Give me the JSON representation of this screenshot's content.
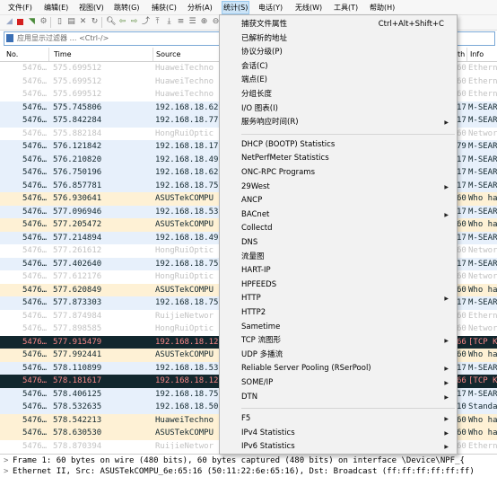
{
  "menubar": [
    "文件(F)",
    "编辑(E)",
    "视图(V)",
    "跳转(G)",
    "捕获(C)",
    "分析(A)",
    "统计(S)",
    "电话(Y)",
    "无线(W)",
    "工具(T)",
    "帮助(H)"
  ],
  "filter": {
    "placeholder": "应用显示过滤器 … <Ctrl-/>"
  },
  "columns": {
    "no": "No.",
    "time": "Time",
    "source": "Source",
    "length_fragment": "th",
    "info": "Info"
  },
  "packets": [
    {
      "no": "5476…",
      "time": "575.699512",
      "src": "HuaweiTechno",
      "len": "60",
      "info": "Ethern",
      "style": "gray"
    },
    {
      "no": "5476…",
      "time": "575.699512",
      "src": "HuaweiTechno",
      "len": "60",
      "info": "Ethern",
      "style": "gray"
    },
    {
      "no": "5476…",
      "time": "575.699512",
      "src": "HuaweiTechno",
      "len": "60",
      "info": "Ethern",
      "style": "gray"
    },
    {
      "no": "5476…",
      "time": "575.745806",
      "src": "192.168.18.62",
      "len": "17",
      "info": "M-SEAR",
      "style": "blue"
    },
    {
      "no": "5476…",
      "time": "575.842284",
      "src": "192.168.18.77",
      "len": "17",
      "info": "M-SEAR",
      "style": "blue"
    },
    {
      "no": "5476…",
      "time": "575.882184",
      "src": "HongRuiOptic",
      "len": "60",
      "info": "Networ",
      "style": "gray"
    },
    {
      "no": "5476…",
      "time": "576.121842",
      "src": "192.168.18.17",
      "len": "79",
      "info": "M-SEAR",
      "style": "blue"
    },
    {
      "no": "5476…",
      "time": "576.210820",
      "src": "192.168.18.49",
      "len": "17",
      "info": "M-SEAR",
      "style": "blue"
    },
    {
      "no": "5476…",
      "time": "576.750196",
      "src": "192.168.18.62",
      "len": "17",
      "info": "M-SEAR",
      "style": "blue"
    },
    {
      "no": "5476…",
      "time": "576.857781",
      "src": "192.168.18.75",
      "len": "17",
      "info": "M-SEAR",
      "style": "blue"
    },
    {
      "no": "5476…",
      "time": "576.930641",
      "src": "ASUSTekCOMPU",
      "len": "60",
      "info": "Who ha",
      "style": "tan"
    },
    {
      "no": "5476…",
      "time": "577.096946",
      "src": "192.168.18.53",
      "len": "17",
      "info": "M-SEAR",
      "style": "blue"
    },
    {
      "no": "5476…",
      "time": "577.205472",
      "src": "ASUSTekCOMPU",
      "len": "60",
      "info": "Who ha",
      "style": "tan"
    },
    {
      "no": "5476…",
      "time": "577.214894",
      "src": "192.168.18.49",
      "len": "17",
      "info": "M-SEAR",
      "style": "blue"
    },
    {
      "no": "5476…",
      "time": "577.261612",
      "src": "HongRuiOptic",
      "len": "60",
      "info": "Networ",
      "style": "gray"
    },
    {
      "no": "5476…",
      "time": "577.402640",
      "src": "192.168.18.75",
      "len": "17",
      "info": "M-SEAR",
      "style": "blue"
    },
    {
      "no": "5476…",
      "time": "577.612176",
      "src": "HongRuiOptic",
      "len": "60",
      "info": "Networ",
      "style": "gray"
    },
    {
      "no": "5476…",
      "time": "577.620849",
      "src": "ASUSTekCOMPU",
      "len": "60",
      "info": "Who ha",
      "style": "tan"
    },
    {
      "no": "5476…",
      "time": "577.873303",
      "src": "192.168.18.75",
      "len": "17",
      "info": "M-SEAR",
      "style": "blue"
    },
    {
      "no": "5476…",
      "time": "577.874984",
      "src": "RuijieNetwor",
      "len": "60",
      "info": "Ethern",
      "style": "gray"
    },
    {
      "no": "5476…",
      "time": "577.898585",
      "src": "HongRuiOptic",
      "len": "60",
      "info": "Networ",
      "style": "gray"
    },
    {
      "no": "5476…",
      "time": "577.915479",
      "src": "192.168.18.12",
      "len": "66",
      "info": "[TCP K",
      "style": "sel"
    },
    {
      "no": "5476…",
      "time": "577.992441",
      "src": "ASUSTekCOMPU",
      "len": "60",
      "info": "Who ha",
      "style": "tan"
    },
    {
      "no": "5476…",
      "time": "578.110899",
      "src": "192.168.18.53",
      "len": "17",
      "info": "M-SEAR",
      "style": "blue"
    },
    {
      "no": "5476…",
      "time": "578.181617",
      "src": "192.168.18.12",
      "len": "66",
      "info": "[TCP K",
      "style": "sel"
    },
    {
      "no": "5476…",
      "time": "578.406125",
      "src": "192.168.18.75",
      "len": "17",
      "info": "M-SEAR",
      "style": "blue"
    },
    {
      "no": "5476…",
      "time": "578.532635",
      "src": "192.168.18.50",
      "len": "10",
      "info": "Standa",
      "style": "blue"
    },
    {
      "no": "5476…",
      "time": "578.542213",
      "src": "HuaweiTechno",
      "len": "60",
      "info": "Who ha",
      "style": "tan"
    },
    {
      "no": "5476…",
      "time": "578.630530",
      "src": "ASUSTekCOMPU",
      "len": "60",
      "info": "Who ha",
      "style": "tan"
    },
    {
      "no": "5476…",
      "time": "578.870394",
      "src": "RuijieNetwor",
      "len": "60",
      "info": "Ethern",
      "style": "gray"
    }
  ],
  "statistics_menu": {
    "items": [
      {
        "label": "捕获文件属性",
        "shortcut": "Ctrl+Alt+Shift+C",
        "submenu": false
      },
      {
        "label": "已解析的地址",
        "shortcut": "",
        "submenu": false
      },
      {
        "label": "协议分级(P)",
        "shortcut": "",
        "submenu": false
      },
      {
        "label": "会话(C)",
        "shortcut": "",
        "submenu": false
      },
      {
        "label": "端点(E)",
        "shortcut": "",
        "submenu": false
      },
      {
        "label": "分组长度",
        "shortcut": "",
        "submenu": false
      },
      {
        "label": "I/O 图表(I)",
        "shortcut": "",
        "submenu": false
      },
      {
        "label": "服务响应时间(R)",
        "shortcut": "",
        "submenu": true
      },
      {
        "separator": true
      },
      {
        "label": "DHCP (BOOTP) Statistics",
        "shortcut": "",
        "submenu": false
      },
      {
        "label": "NetPerfMeter Statistics",
        "shortcut": "",
        "submenu": false
      },
      {
        "label": "ONC-RPC Programs",
        "shortcut": "",
        "submenu": false
      },
      {
        "label": "29West",
        "shortcut": "",
        "submenu": true
      },
      {
        "label": "ANCP",
        "shortcut": "",
        "submenu": false
      },
      {
        "label": "BACnet",
        "shortcut": "",
        "submenu": true
      },
      {
        "label": "Collectd",
        "shortcut": "",
        "submenu": false
      },
      {
        "label": "DNS",
        "shortcut": "",
        "submenu": false
      },
      {
        "label": "流量图",
        "shortcut": "",
        "submenu": false
      },
      {
        "label": "HART-IP",
        "shortcut": "",
        "submenu": false
      },
      {
        "label": "HPFEEDS",
        "shortcut": "",
        "submenu": false
      },
      {
        "label": "HTTP",
        "shortcut": "",
        "submenu": true
      },
      {
        "label": "HTTP2",
        "shortcut": "",
        "submenu": false
      },
      {
        "label": "Sametime",
        "shortcut": "",
        "submenu": false
      },
      {
        "label": "TCP 流图形",
        "shortcut": "",
        "submenu": true
      },
      {
        "label": "UDP 多播流",
        "shortcut": "",
        "submenu": false
      },
      {
        "label": "Reliable Server Pooling (RSerPool)",
        "shortcut": "",
        "submenu": true
      },
      {
        "label": "SOME/IP",
        "shortcut": "",
        "submenu": true
      },
      {
        "label": "DTN",
        "shortcut": "",
        "submenu": true
      },
      {
        "separator": true
      },
      {
        "label": "F5",
        "shortcut": "",
        "submenu": true
      },
      {
        "label": "IPv4 Statistics",
        "shortcut": "",
        "submenu": true
      },
      {
        "label": "IPv6 Statistics",
        "shortcut": "",
        "submenu": true
      }
    ]
  },
  "detail": {
    "line1": "Frame 1: 60 bytes on wire (480 bits), 60 bytes captured (480 bits) on interface \\Device\\NPF_{",
    "line2": "Ethernet II, Src: ASUSTekCOMPU_6e:65:16 (50:11:22:6e:65:16), Dst: Broadcast (ff:ff:ff:ff:ff:ff)"
  },
  "colors": {
    "selected_bg": "#12272e",
    "selected_fg": "#f78787",
    "udp_bg": "#e7f0fb",
    "arp_bg": "#fef1d5",
    "ignored_fg": "#c2c2c2"
  }
}
